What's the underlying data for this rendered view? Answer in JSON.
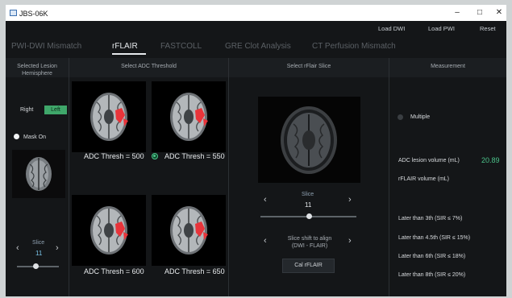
{
  "window": {
    "title": "JBS-06K",
    "controls": {
      "minimize": "–",
      "maximize": "□",
      "close": "✕"
    }
  },
  "toplinks": {
    "load_dwi": "Load DWI",
    "load_pwi": "Load PWI",
    "reset": "Reset"
  },
  "tabs": [
    {
      "label": "PWI-DWI Mismatch"
    },
    {
      "label": "rFLAIR",
      "active": true
    },
    {
      "label": "FASTCOLL"
    },
    {
      "label": "GRE Clot Analysis"
    },
    {
      "label": "CT Perfusion Mismatch"
    }
  ],
  "sections": {
    "hemisphere_title_1": "Selected Lesion",
    "hemisphere_title_2": "Hemisphere",
    "adc_title": "Select ADC Threshold",
    "flair_title": "Select rFlair Slice",
    "measurement_title": "Measurement"
  },
  "hemisphere": {
    "right_label": "Right",
    "left_label": "Left",
    "selected": "Left"
  },
  "mask": {
    "label": "Mask On"
  },
  "left_slice": {
    "label": "Slice",
    "value": "11",
    "fraction": 0.45
  },
  "adc_thresholds": [
    {
      "label": "ADC Thresh = 500",
      "selected": false
    },
    {
      "label": "ADC Thresh = 550",
      "selected": true
    },
    {
      "label": "ADC Thresh = 600",
      "selected": false
    },
    {
      "label": "ADC Thresh = 650",
      "selected": false
    }
  ],
  "flair": {
    "slice_label": "Slice",
    "slice_value": "11",
    "slice_fraction": 0.5,
    "shift_label_1": "Slice shift to align",
    "shift_label_2": "(DWI - FLAIR)",
    "cal_button": "Cal rFLAIR"
  },
  "measurement": {
    "multiple_label": "Multiple",
    "adc_volume_label": "ADC lesion volume (mL)",
    "adc_volume_value": "20.89",
    "flair_volume_label": "rFLAIR volume (mL)",
    "later_rows": [
      "Later than 3th  (SIR ≤ 7%)",
      "Later than 4.5th (SIR ≤ 15%)",
      "Later than 6th  (SIR ≤ 18%)",
      "Later than 8th  (SIR ≤ 20%)"
    ]
  },
  "colors": {
    "accent_green": "#4cc38a",
    "badge_green": "#3fa76a",
    "lesion_red": "#e8343a"
  }
}
